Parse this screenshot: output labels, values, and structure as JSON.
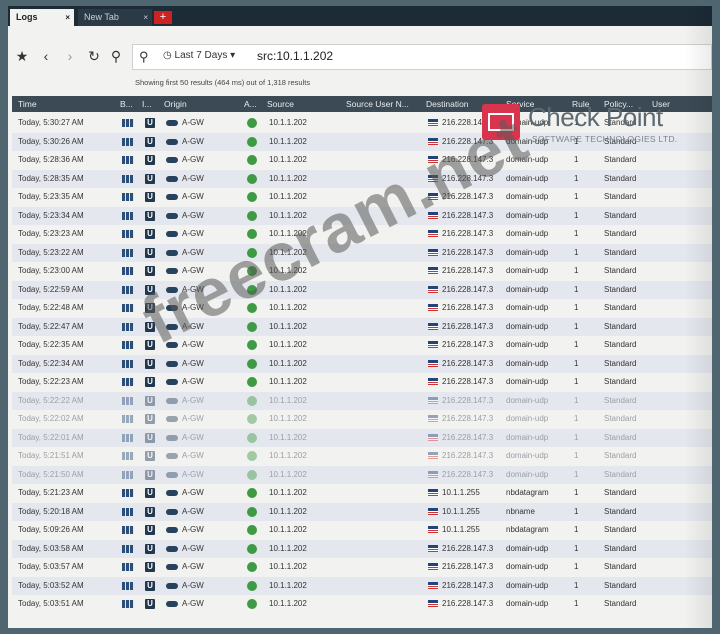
{
  "tabs": [
    {
      "label": "Logs",
      "close": "×"
    },
    {
      "label": "New Tab",
      "close": "×"
    }
  ],
  "tab_add_icon": "+",
  "toolbar": {
    "time_filter": "Last 7 Days",
    "query": "src:10.1.1.202",
    "results_info": "Showing first 50 results (464 ms) out of 1,318 results"
  },
  "columns": [
    "Time",
    "B...",
    "I...",
    "Origin",
    "A...",
    "Source",
    "Source User N...",
    "Destination",
    "Service",
    "Rule",
    "Policy...",
    "User"
  ],
  "rows": [
    {
      "time": "Today, 5:30:27 AM",
      "origin": "A-GW",
      "source": "10.1.1.202",
      "destination": "216.228.147.3",
      "service": "domain-udp",
      "rule": "1",
      "policy": "Standard"
    },
    {
      "time": "Today, 5:30:26 AM",
      "origin": "A-GW",
      "source": "10.1.1.202",
      "destination": "216.228.147.3",
      "service": "domain-udp",
      "rule": "1",
      "policy": "Standard"
    },
    {
      "time": "Today, 5:28:36 AM",
      "origin": "A-GW",
      "source": "10.1.1.202",
      "destination": "216.228.147.3",
      "service": "domain-udp",
      "rule": "1",
      "policy": "Standard"
    },
    {
      "time": "Today, 5:28:35 AM",
      "origin": "A-GW",
      "source": "10.1.1.202",
      "destination": "216.228.147.3",
      "service": "domain-udp",
      "rule": "1",
      "policy": "Standard"
    },
    {
      "time": "Today, 5:23:35 AM",
      "origin": "A-GW",
      "source": "10.1.1.202",
      "destination": "216.228.147.3",
      "service": "domain-udp",
      "rule": "1",
      "policy": "Standard"
    },
    {
      "time": "Today, 5:23:34 AM",
      "origin": "A-GW",
      "source": "10.1.1.202",
      "destination": "216.228.147.3",
      "service": "domain-udp",
      "rule": "1",
      "policy": "Standard"
    },
    {
      "time": "Today, 5:23:23 AM",
      "origin": "A-GW",
      "source": "10.1.1.202",
      "destination": "216.228.147.3",
      "service": "domain-udp",
      "rule": "1",
      "policy": "Standard"
    },
    {
      "time": "Today, 5:23:22 AM",
      "origin": "A-GW",
      "source": "10.1.1.202",
      "destination": "216.228.147.3",
      "service": "domain-udp",
      "rule": "1",
      "policy": "Standard"
    },
    {
      "time": "Today, 5:23:00 AM",
      "origin": "A-GW",
      "source": "10.1.1.202",
      "destination": "216.228.147.3",
      "service": "domain-udp",
      "rule": "1",
      "policy": "Standard"
    },
    {
      "time": "Today, 5:22:59 AM",
      "origin": "A-GW",
      "source": "10.1.1.202",
      "destination": "216.228.147.3",
      "service": "domain-udp",
      "rule": "1",
      "policy": "Standard"
    },
    {
      "time": "Today, 5:22:48 AM",
      "origin": "A-GW",
      "source": "10.1.1.202",
      "destination": "216.228.147.3",
      "service": "domain-udp",
      "rule": "1",
      "policy": "Standard"
    },
    {
      "time": "Today, 5:22:47 AM",
      "origin": "A-GW",
      "source": "10.1.1.202",
      "destination": "216.228.147.3",
      "service": "domain-udp",
      "rule": "1",
      "policy": "Standard"
    },
    {
      "time": "Today, 5:22:35 AM",
      "origin": "A-GW",
      "source": "10.1.1.202",
      "destination": "216.228.147.3",
      "service": "domain-udp",
      "rule": "1",
      "policy": "Standard"
    },
    {
      "time": "Today, 5:22:34 AM",
      "origin": "A-GW",
      "source": "10.1.1.202",
      "destination": "216.228.147.3",
      "service": "domain-udp",
      "rule": "1",
      "policy": "Standard"
    },
    {
      "time": "Today, 5:22:23 AM",
      "origin": "A-GW",
      "source": "10.1.1.202",
      "destination": "216.228.147.3",
      "service": "domain-udp",
      "rule": "1",
      "policy": "Standard"
    },
    {
      "time": "Today, 5:22:22 AM",
      "origin": "A-GW",
      "source": "10.1.1.202",
      "destination": "216.228.147.3",
      "service": "domain-udp",
      "rule": "1",
      "policy": "Standard"
    },
    {
      "time": "Today, 5:22:02 AM",
      "origin": "A-GW",
      "source": "10.1.1.202",
      "destination": "216.228.147.3",
      "service": "domain-udp",
      "rule": "1",
      "policy": "Standard"
    },
    {
      "time": "Today, 5:22:01 AM",
      "origin": "A-GW",
      "source": "10.1.1.202",
      "destination": "216.228.147.3",
      "service": "domain-udp",
      "rule": "1",
      "policy": "Standard"
    },
    {
      "time": "Today, 5:21:51 AM",
      "origin": "A-GW",
      "source": "10.1.1.202",
      "destination": "216.228.147.3",
      "service": "domain-udp",
      "rule": "1",
      "policy": "Standard"
    },
    {
      "time": "Today, 5:21:50 AM",
      "origin": "A-GW",
      "source": "10.1.1.202",
      "destination": "216.228.147.3",
      "service": "domain-udp",
      "rule": "1",
      "policy": "Standard"
    },
    {
      "time": "Today, 5:21:23 AM",
      "origin": "A-GW",
      "source": "10.1.1.202",
      "destination": "10.1.1.255",
      "service": "nbdatagram",
      "rule": "1",
      "policy": "Standard"
    },
    {
      "time": "Today, 5:20:18 AM",
      "origin": "A-GW",
      "source": "10.1.1.202",
      "destination": "10.1.1.255",
      "service": "nbname",
      "rule": "1",
      "policy": "Standard"
    },
    {
      "time": "Today, 5:09:26 AM",
      "origin": "A-GW",
      "source": "10.1.1.202",
      "destination": "10.1.1.255",
      "service": "nbdatagram",
      "rule": "1",
      "policy": "Standard"
    },
    {
      "time": "Today, 5:03:58 AM",
      "origin": "A-GW",
      "source": "10.1.1.202",
      "destination": "216.228.147.3",
      "service": "domain-udp",
      "rule": "1",
      "policy": "Standard"
    },
    {
      "time": "Today, 5:03:57 AM",
      "origin": "A-GW",
      "source": "10.1.1.202",
      "destination": "216.228.147.3",
      "service": "domain-udp",
      "rule": "1",
      "policy": "Standard"
    },
    {
      "time": "Today, 5:03:52 AM",
      "origin": "A-GW",
      "source": "10.1.1.202",
      "destination": "216.228.147.3",
      "service": "domain-udp",
      "rule": "1",
      "policy": "Standard"
    },
    {
      "time": "Today, 5:03:51 AM",
      "origin": "A-GW",
      "source": "10.1.1.202",
      "destination": "216.228.147.3",
      "service": "domain-udp",
      "rule": "1",
      "policy": "Standard"
    }
  ],
  "logo": {
    "brand": "Check Point",
    "tagline": "SOFTWARE TECHNOLOGIES LTD."
  },
  "watermark": "freecram.net"
}
